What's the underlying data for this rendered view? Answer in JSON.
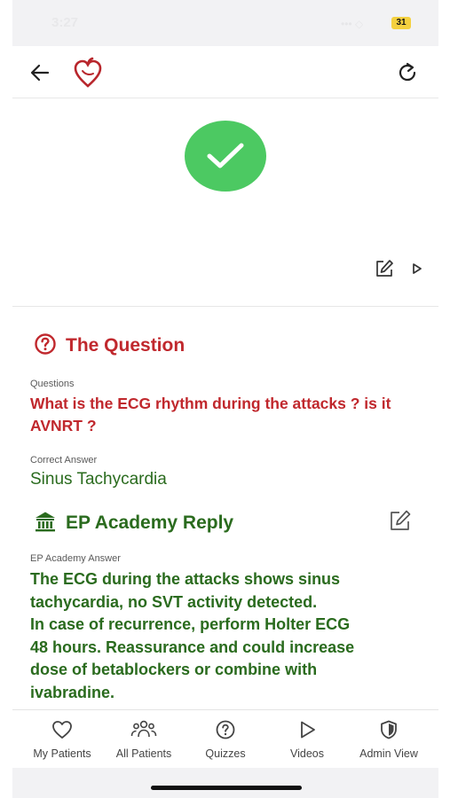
{
  "status_bar": {
    "time": "3:27",
    "signal": "••• ◇",
    "battery": "31"
  },
  "colors": {
    "question_red": "#c0282d",
    "reply_green": "#2a6b1e",
    "success_green": "#4cc962"
  },
  "header": {
    "back_icon": "arrow-left",
    "logo_icon": "heart-outline",
    "refresh_icon": "refresh"
  },
  "result": {
    "icon": "checkmark-circle"
  },
  "question_section": {
    "title": "The Question",
    "questions_label": "Questions",
    "question": "What is the ECG rhythm during the attacks ? is it AVNRT ?",
    "correct_answer_label": "Correct Answer",
    "correct_answer": "Sinus Tachycardia"
  },
  "reply_section": {
    "title": "EP Academy Reply",
    "answer_label": "EP Academy Answer",
    "answer_lines": [
      "The ECG during the attacks shows sinus",
      "tachycardia, no SVT activity detected.",
      "In case of recurrence, perform Holter ECG",
      "48 hours. Reassurance and could increase",
      "dose of betablockers or combine with",
      "ivabradine."
    ]
  },
  "tabs": [
    {
      "label": "My Patients",
      "icon": "heart-outline"
    },
    {
      "label": "All Patients",
      "icon": "people"
    },
    {
      "label": "Quizzes",
      "icon": "question-circle"
    },
    {
      "label": "Videos",
      "icon": "play"
    },
    {
      "label": "Admin View",
      "icon": "shield"
    }
  ]
}
